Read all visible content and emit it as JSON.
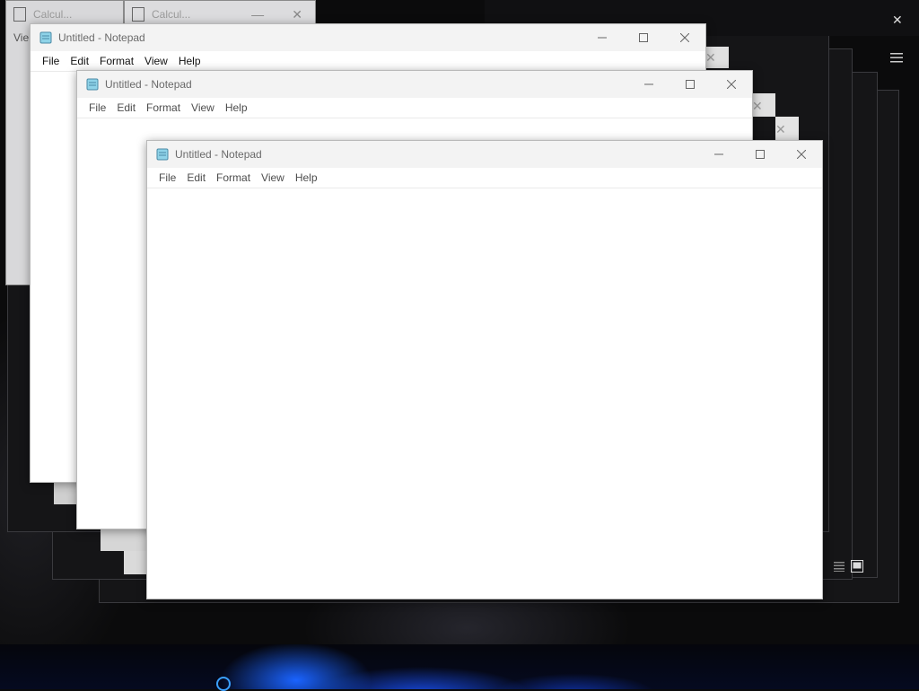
{
  "windows": {
    "calc_1_title": "Calcul...",
    "calc_2_title": "Calcul...",
    "calc_menu_partial": "Vie",
    "notepad_back": {
      "title": "Untitled - Notepad",
      "menu": [
        "File",
        "Edit",
        "Format",
        "View",
        "Help"
      ]
    },
    "notepad_mid": {
      "title": "Untitled - Notepad",
      "menu": [
        "File",
        "Edit",
        "Format",
        "View",
        "Help"
      ]
    },
    "notepad_front": {
      "title": "Untitled - Notepad",
      "menu": [
        "File",
        "Edit",
        "Format",
        "View",
        "Help"
      ]
    }
  },
  "icons": {
    "notepad_app": "notepad-icon",
    "minimize": "minimize-icon",
    "maximize": "maximize-icon",
    "close": "close-icon",
    "hamburger": "hamburger-menu-icon",
    "details_view": "details-view-icon",
    "preview_view": "preview-view-icon"
  },
  "colors": {
    "titlebar": "#f3f3f3",
    "window_bg": "#ffffff",
    "desktop_bg": "#0b0b0c",
    "taskbar_accent": "#1a63ff"
  }
}
